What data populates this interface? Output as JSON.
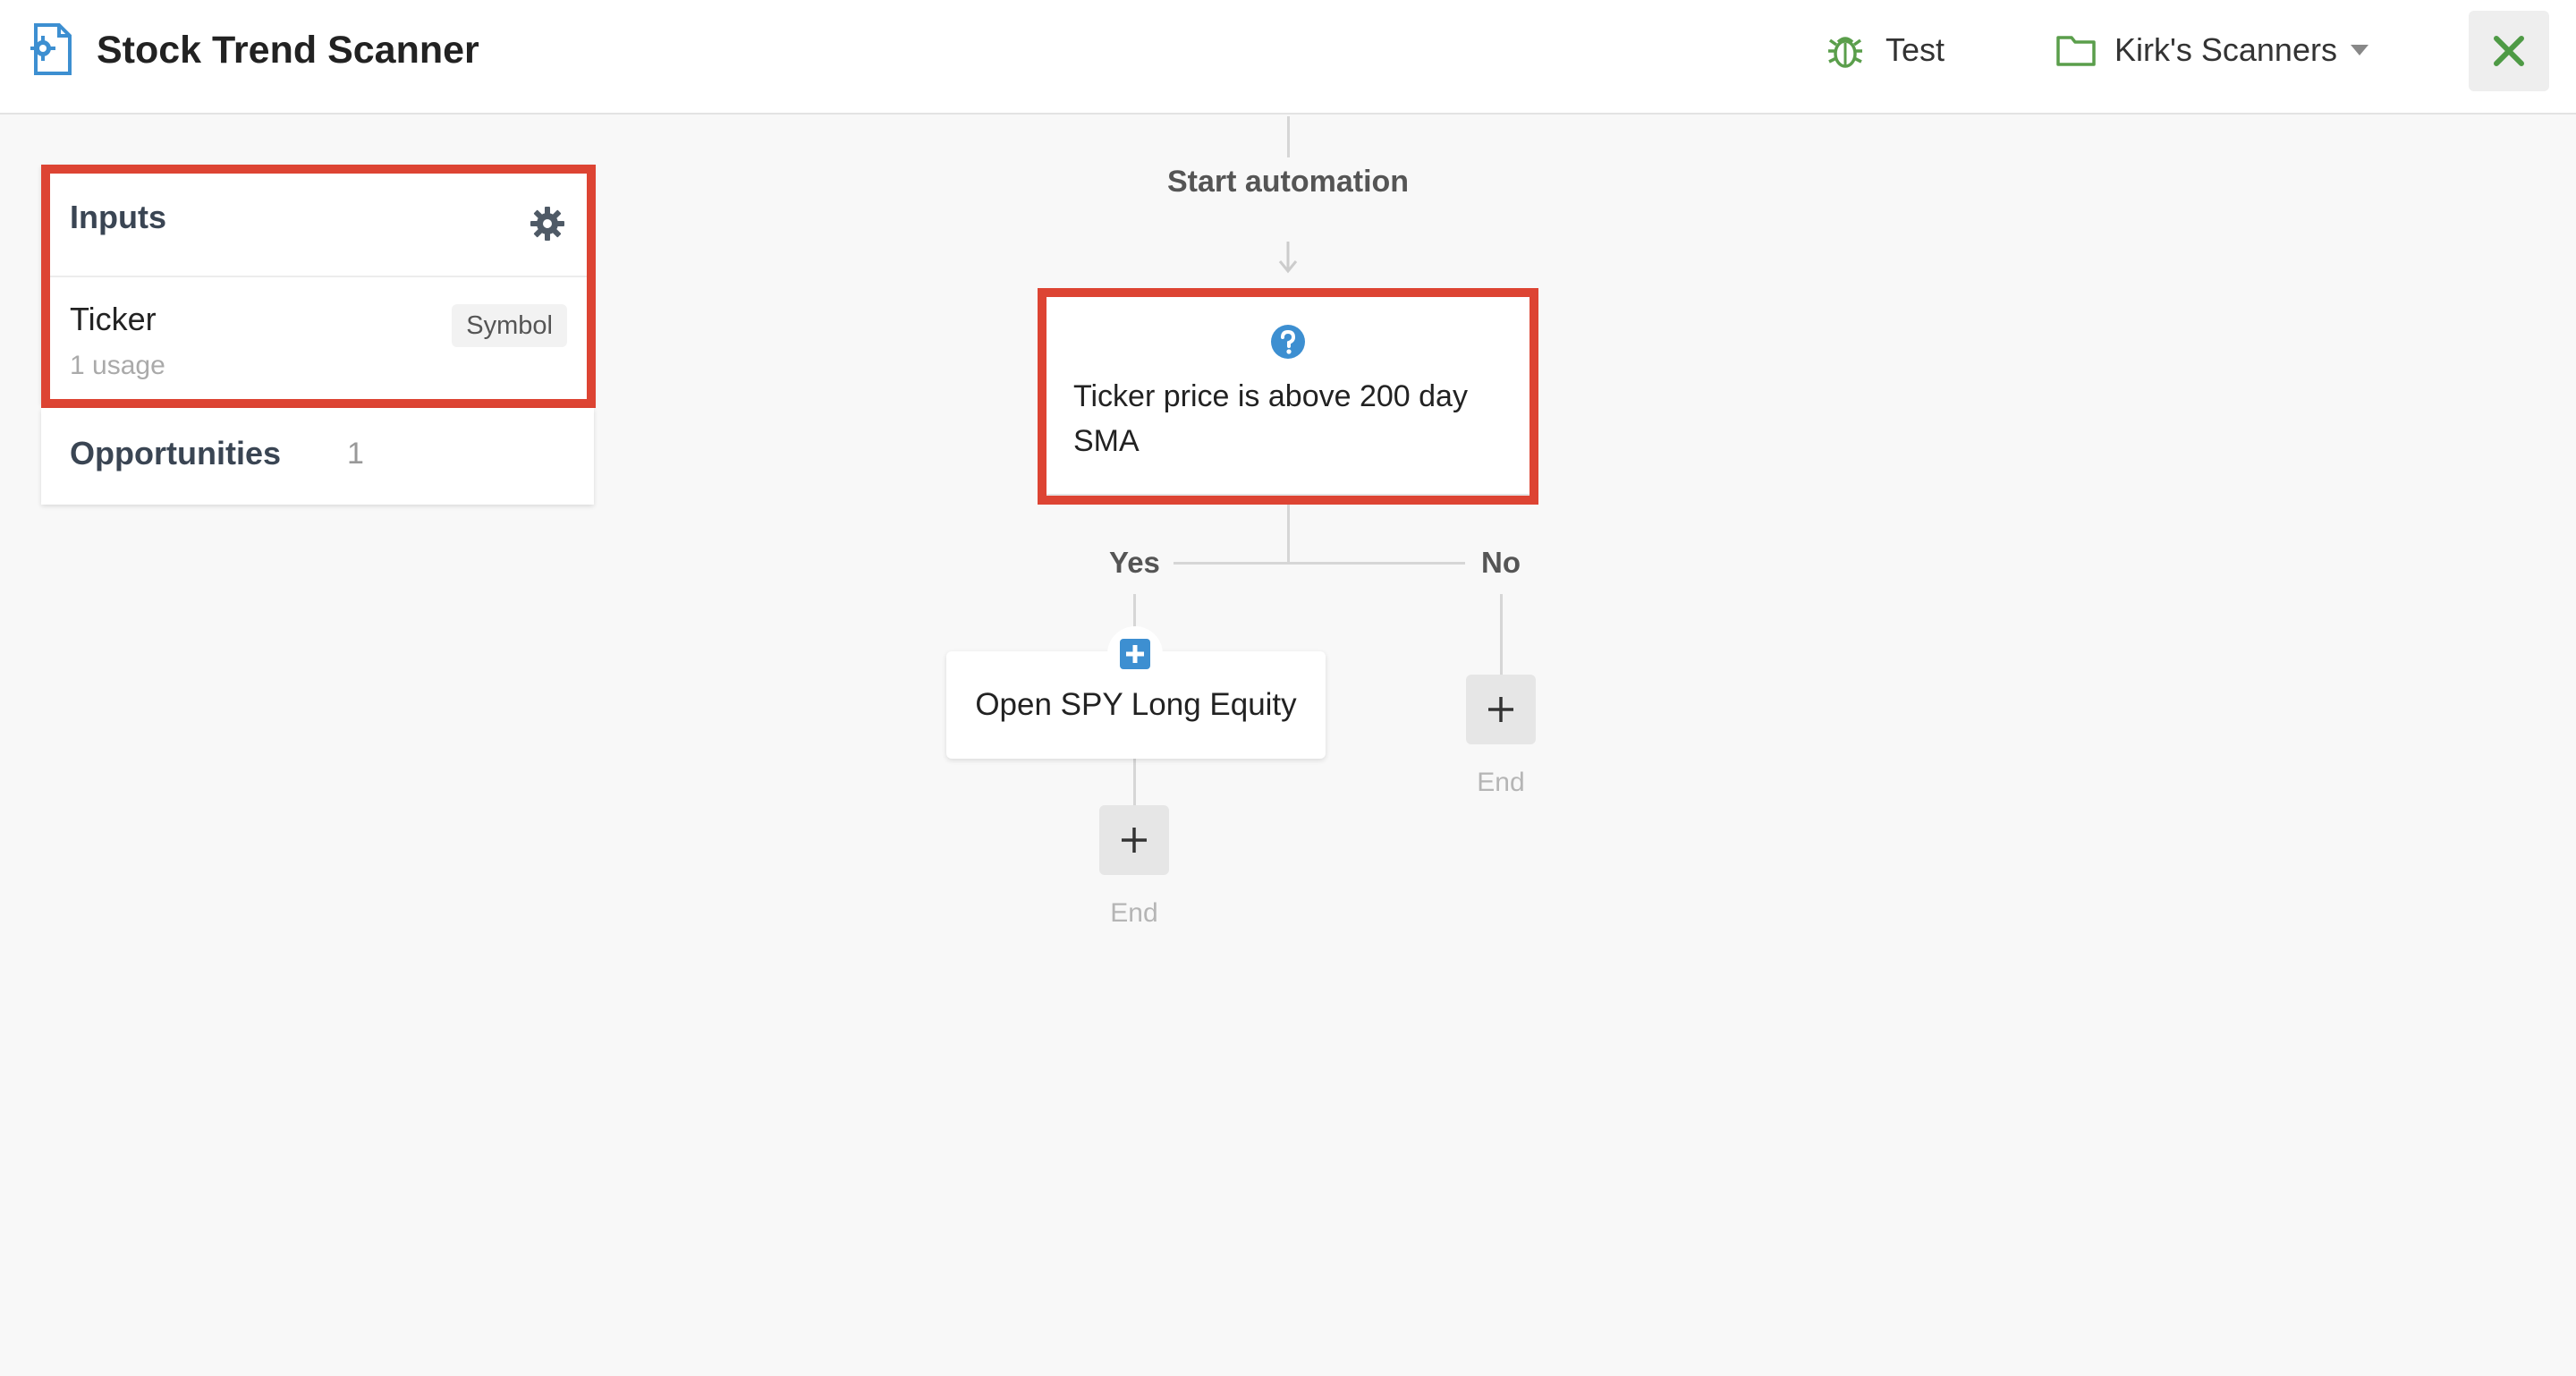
{
  "header": {
    "title": "Stock Trend Scanner",
    "test_label": "Test",
    "folder_label": "Kirk's Scanners",
    "icons": {
      "app": "scanner-app-icon",
      "test": "bug-icon",
      "folder": "folder-icon",
      "caret": "caret-down-icon",
      "close": "close-icon"
    },
    "accent_color": "#5a9e4b"
  },
  "inputs_panel": {
    "title": "Inputs",
    "items": [
      {
        "name": "Ticker",
        "type": "Symbol",
        "usage": "1 usage"
      }
    ]
  },
  "opportunities": {
    "label": "Opportunities",
    "count": "1"
  },
  "flow": {
    "start_label": "Start automation",
    "condition": {
      "text": "Ticker price is above 200 day SMA",
      "icon": "question-circle-icon"
    },
    "yes_label": "Yes",
    "no_label": "No",
    "yes_branch": {
      "action_text": "Open SPY Long Equity",
      "icon": "plus-square-icon",
      "end_label": "End"
    },
    "no_branch": {
      "end_label": "End"
    }
  },
  "highlight_color": "#dd4433"
}
